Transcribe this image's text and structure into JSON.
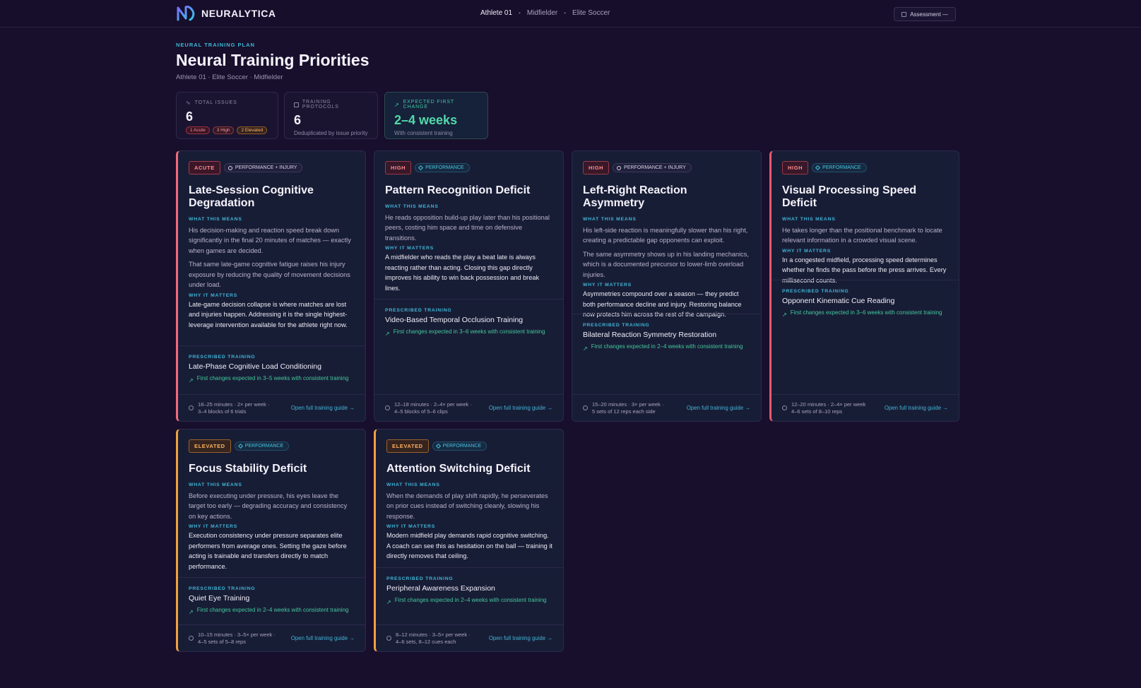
{
  "app": {
    "logo_text": "NEURALYTICA"
  },
  "breadcrumb": [
    "Athlete 01",
    "Midfielder",
    "Elite Soccer"
  ],
  "header_button": {
    "label": "Assessment —",
    "icon": "calendar-icon"
  },
  "page": {
    "eyebrow": "NEURAL TRAINING PLAN",
    "title": "Neural Training Priorities",
    "subtitle": "Athlete 01 · Elite Soccer · Midfielder"
  },
  "stats": {
    "total_issues": {
      "label": "TOTAL ISSUES",
      "value": "6",
      "pills": [
        "1 Acute",
        "3 High",
        "2 Elevated"
      ]
    },
    "protocols": {
      "label": "TRAINING PROTOCOLS",
      "value": "6",
      "note": "Deduplicated by issue priority"
    },
    "first_change": {
      "label": "EXPECTED FIRST CHANGE",
      "value": "2–4 weeks",
      "note": "With consistent training"
    }
  },
  "labels": {
    "what": "WHAT THIS MEANS",
    "why": "WHY IT MATTERS",
    "prescribed": "PRESCRIBED TRAINING",
    "guide": "Open full training guide →"
  },
  "colors": {
    "acute": "#f26a7e",
    "high": "#ff8b8b",
    "elevated": "#f0a23d",
    "accent": "#3fb5d6",
    "positive": "#42c99b"
  },
  "cards": [
    {
      "severity": "ACUTE",
      "type": "PERFORMANCE + INJURY",
      "title": "Late-Session Cognitive Degradation",
      "what": [
        "His decision-making and reaction speed break down significantly in the final 20 minutes of matches — exactly when games are decided.",
        "That same late-game cognitive fatigue raises his injury exposure by reducing the quality of movement decisions under load."
      ],
      "why": "Late-game decision collapse is where matches are lost and injuries happen. Addressing it is the single highest-leverage intervention available for the athlete right now.",
      "training": "Late-Phase Cognitive Load Conditioning",
      "eta": "First changes expected in 3–5 weeks with consistent training",
      "dose": [
        "18–25 minutes · 2× per week ·",
        "3–4 blocks of 6 trials"
      ]
    },
    {
      "severity": "HIGH",
      "type": "PERFORMANCE",
      "title": "Pattern Recognition Deficit",
      "what": [
        "He reads opposition build-up play later than his positional peers, costing him space and time on defensive transitions."
      ],
      "why": "A midfielder who reads the play a beat late is always reacting rather than acting. Closing this gap directly improves his ability to win back possession and break lines.",
      "training": "Video-Based Temporal Occlusion Training",
      "eta": "First changes expected in 3–6 weeks with consistent training",
      "dose": [
        "12–18 minutes · 2–4× per week ·",
        "4–5 blocks of 5–6 clips"
      ]
    },
    {
      "severity": "HIGH",
      "type": "PERFORMANCE + INJURY",
      "title": "Left-Right Reaction Asymmetry",
      "what": [
        "His left-side reaction is meaningfully slower than his right, creating a predictable gap opponents can exploit.",
        "The same asymmetry shows up in his landing mechanics, which is a documented precursor to lower-limb overload injuries."
      ],
      "why": "Asymmetries compound over a season — they predict both performance decline and injury. Restoring balance now protects him across the rest of the campaign.",
      "training": "Bilateral Reaction Symmetry Restoration",
      "eta": "First changes expected in 2–4 weeks with consistent training",
      "dose": [
        "15–20 minutes · 3× per week ·",
        "5 sets of 12 reps each side"
      ]
    },
    {
      "severity": "HIGH",
      "type": "PERFORMANCE",
      "title": "Visual Processing Speed Deficit",
      "what": [
        "He takes longer than the positional benchmark to locate relevant information in a crowded visual scene."
      ],
      "why": "In a congested midfield, processing speed determines whether he finds the pass before the press arrives. Every millisecond counts.",
      "training": "Opponent Kinematic Cue Reading",
      "eta": "First changes expected in 3–6 weeks with consistent training",
      "dose": [
        "12–20 minutes · 2–4× per week",
        "4–6 sets of 8–10 reps"
      ]
    },
    {
      "severity": "ELEVATED",
      "type": "PERFORMANCE",
      "title": "Focus Stability Deficit",
      "what": [
        "Before executing under pressure, his eyes leave the target too early — degrading accuracy and consistency on key actions."
      ],
      "why": "Execution consistency under pressure separates elite performers from average ones. Setting the gaze before acting is trainable and transfers directly to match performance.",
      "training": "Quiet Eye Training",
      "eta": "First changes expected in 2–4 weeks with consistent training",
      "dose": [
        "10–15 minutes · 3–5× per week ·",
        "4–5 sets of 5–8 reps"
      ]
    },
    {
      "severity": "ELEVATED",
      "type": "PERFORMANCE",
      "title": "Attention Switching Deficit",
      "what": [
        "When the demands of play shift rapidly, he perseverates on prior cues instead of switching cleanly, slowing his response."
      ],
      "why": "Modern midfield play demands rapid cognitive switching. A coach can see this as hesitation on the ball — training it directly removes that ceiling.",
      "training": "Peripheral Awareness Expansion",
      "eta": "First changes expected in 2–4 weeks with consistent training",
      "dose": [
        "8–12 minutes · 3–5× per week ·",
        "4–6 sets, 8–12 cues each"
      ]
    }
  ]
}
